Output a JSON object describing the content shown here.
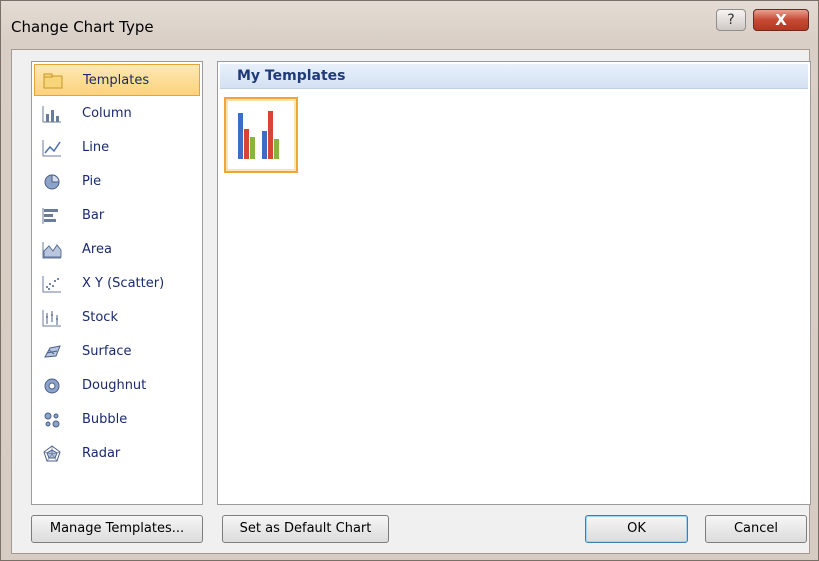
{
  "dialog": {
    "title": "Change Chart Type",
    "help_glyph": "?",
    "close_glyph": "X"
  },
  "categories": [
    {
      "label": "Templates",
      "icon": "folder-icon",
      "selected": true
    },
    {
      "label": "Column",
      "icon": "column-chart-icon"
    },
    {
      "label": "Line",
      "icon": "line-chart-icon"
    },
    {
      "label": "Pie",
      "icon": "pie-chart-icon"
    },
    {
      "label": "Bar",
      "icon": "bar-chart-icon"
    },
    {
      "label": "Area",
      "icon": "area-chart-icon"
    },
    {
      "label": "X Y (Scatter)",
      "icon": "scatter-chart-icon"
    },
    {
      "label": "Stock",
      "icon": "stock-chart-icon"
    },
    {
      "label": "Surface",
      "icon": "surface-chart-icon"
    },
    {
      "label": "Doughnut",
      "icon": "doughnut-chart-icon"
    },
    {
      "label": "Bubble",
      "icon": "bubble-chart-icon"
    },
    {
      "label": "Radar",
      "icon": "radar-chart-icon"
    }
  ],
  "templates_section": {
    "title": "My Templates"
  },
  "buttons": {
    "manage_templates": "Manage Templates...",
    "set_default": "Set as Default Chart",
    "ok": "OK",
    "cancel": "Cancel"
  },
  "colors": {
    "selection_border": "#e3a53b",
    "header_text": "#1f3a78",
    "category_text": "#1a2a6c"
  }
}
